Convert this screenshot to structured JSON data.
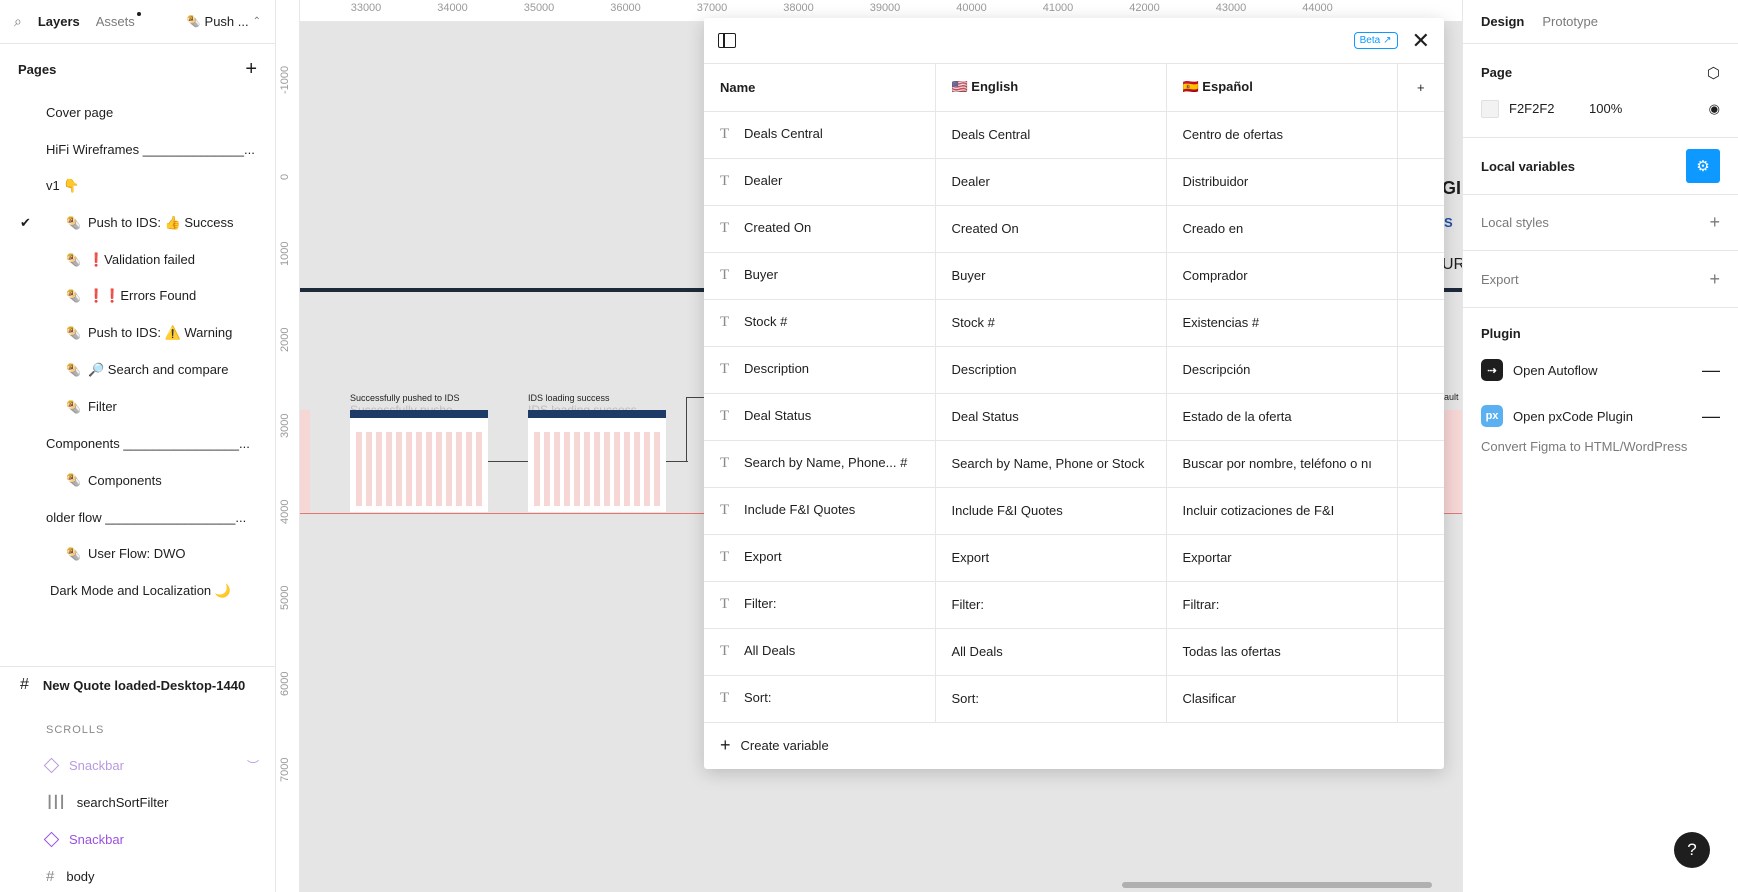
{
  "left_panel": {
    "tabs": {
      "layers": "Layers",
      "assets": "Assets",
      "page_selector": "Push ..."
    },
    "pages_header": "Pages",
    "pages": [
      {
        "label": "Cover page",
        "level": 1,
        "icon": ""
      },
      {
        "label": "HiFi Wireframes ______________...",
        "level": 1,
        "icon": ""
      },
      {
        "label": "v1 👇",
        "level": 1,
        "icon": ""
      },
      {
        "label": "Push to IDS: 👍 Success",
        "level": 2,
        "icon": "🌯",
        "selected": true
      },
      {
        "label": "❗Validation failed",
        "level": 2,
        "icon": "🌯"
      },
      {
        "label": "❗❗Errors Found",
        "level": 2,
        "icon": "🌯"
      },
      {
        "label": "Push to IDS: ⚠️ Warning",
        "level": 2,
        "icon": "🌯"
      },
      {
        "label": "🔎 Search and compare",
        "level": 2,
        "icon": "🌯"
      },
      {
        "label": "Filter",
        "level": 2,
        "icon": "🌯"
      },
      {
        "label": "Components ________________...",
        "level": 1,
        "icon": ""
      },
      {
        "label": "Components",
        "level": 2,
        "icon": "🌯"
      },
      {
        "label": "older flow __________________...",
        "level": 1,
        "icon": ""
      },
      {
        "label": "User Flow: DWO",
        "level": 2,
        "icon": "🌯"
      },
      {
        "label": "Dark Mode and Localization 🌙",
        "level": 1,
        "icon": ""
      }
    ],
    "frame_title": "New Quote loaded-Desktop-1440",
    "section_label": "SCROLLS",
    "layers": [
      {
        "label": "Snackbar",
        "icon": "diamond"
      },
      {
        "label": "searchSortFilter",
        "icon": "columns"
      },
      {
        "label": "Snackbar",
        "icon": "diamond"
      },
      {
        "label": "body",
        "icon": "hash"
      }
    ]
  },
  "canvas": {
    "ruler_top": [
      "33000",
      "34000",
      "35000",
      "36000",
      "37000",
      "38000",
      "39000",
      "40000",
      "41000",
      "42000",
      "43000",
      "44000"
    ],
    "ruler_left": [
      "-1000",
      "0",
      "1000",
      "2000",
      "3000",
      "4000",
      "5000",
      "6000",
      "7000"
    ],
    "thumb_labels": [
      "Successfully pushed to IDS",
      "IDS loading success"
    ],
    "thumb_ghost_labels": [
      "Successfully pushe...",
      "IDS loading success..."
    ],
    "edge_texts": [
      "GI",
      "S",
      "UR"
    ],
    "edge_label": "ault"
  },
  "modal": {
    "beta_label": "Beta",
    "columns": [
      "Name",
      "🇺🇸 English",
      "🇪🇸 Español"
    ],
    "rows": [
      {
        "name": "Deals Central",
        "en": "Deals Central",
        "es": "Centro de ofertas"
      },
      {
        "name": "Dealer",
        "en": "Dealer",
        "es": "Distribuidor"
      },
      {
        "name": "Created On",
        "en": "Created On",
        "es": "Creado en"
      },
      {
        "name": "Buyer",
        "en": "Buyer",
        "es": "Comprador"
      },
      {
        "name": "Stock #",
        "en": "Stock #",
        "es": "Existencias #"
      },
      {
        "name": "Description",
        "en": "Description",
        "es": "Descripción"
      },
      {
        "name": "Deal Status",
        "en": "Deal Status",
        "es": "Estado de la oferta"
      },
      {
        "name": "Search by Name, Phone... #",
        "en": "Search by Name, Phone or Stock",
        "es": "Buscar por nombre, teléfono o nı"
      },
      {
        "name": "Include F&I Quotes",
        "en": "Include F&I Quotes",
        "es": "Incluir cotizaciones de F&I"
      },
      {
        "name": "Export",
        "en": "Export",
        "es": "Exportar"
      },
      {
        "name": "Filter:",
        "en": "Filter:",
        "es": "Filtrar:"
      },
      {
        "name": "All Deals",
        "en": "All Deals",
        "es": "Todas las ofertas"
      },
      {
        "name": "Sort:",
        "en": "Sort:",
        "es": "Clasificar"
      }
    ],
    "create_label": "Create variable"
  },
  "right_panel": {
    "tabs": {
      "design": "Design",
      "prototype": "Prototype"
    },
    "page_header": "Page",
    "page_color": "F2F2F2",
    "page_opacity": "100%",
    "local_variables": "Local variables",
    "local_styles": "Local styles",
    "export": "Export",
    "plugin_header": "Plugin",
    "plugins": [
      {
        "name": "Open Autoflow",
        "logo_text": "",
        "color": "#1e1e1e"
      },
      {
        "name": "Open pxCode Plugin",
        "logo_text": "px",
        "color": "#5ab0f0"
      }
    ],
    "plugin_description": "Convert Figma to HTML/WordPress",
    "help_label": "?"
  },
  "colors": {
    "accent": "#0d99ff",
    "page_bg": "#F2F2F2",
    "purple": "#9b51e0"
  }
}
